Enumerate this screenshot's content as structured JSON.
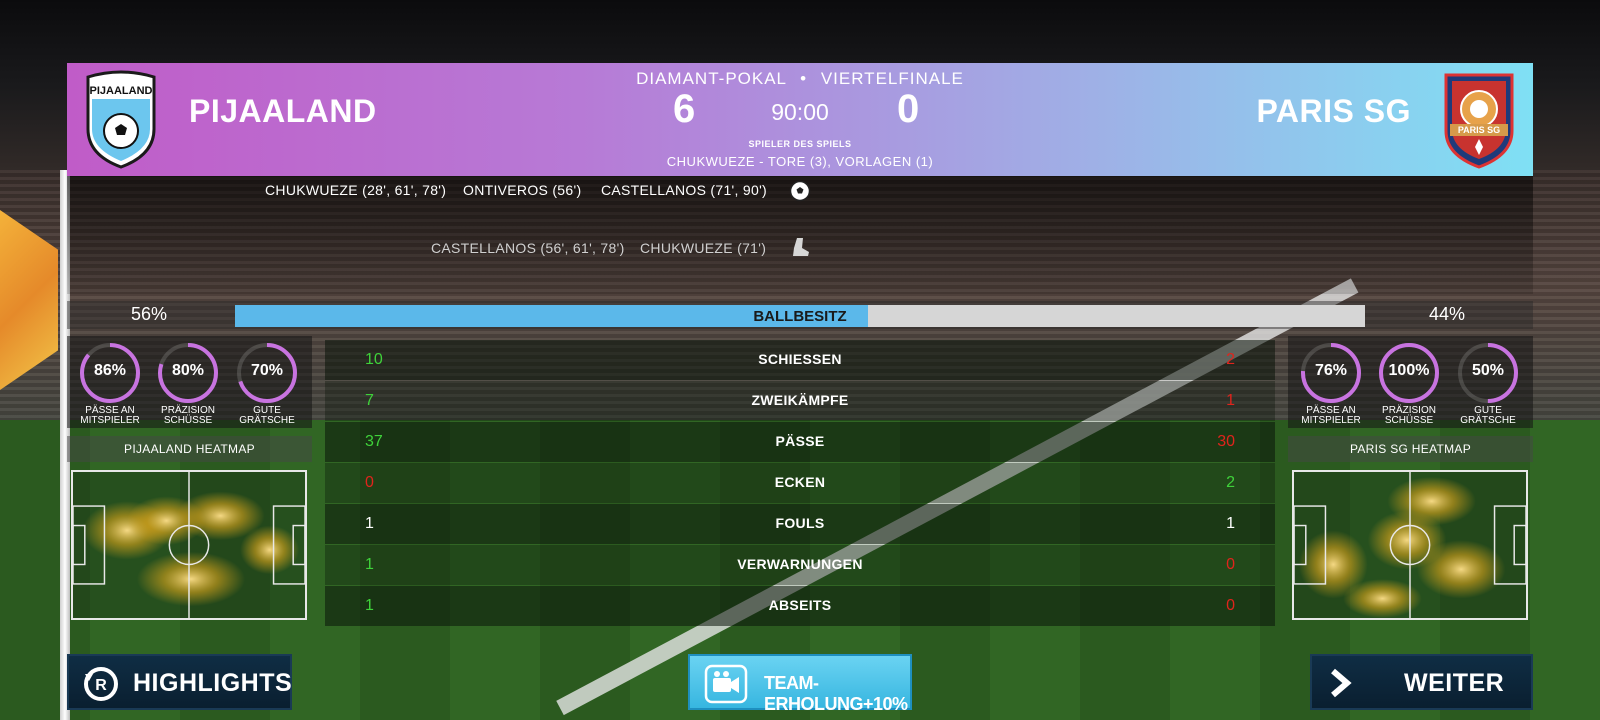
{
  "match": {
    "competition": "DIAMANT-POKAL",
    "separator": "•",
    "round": "VIERTELFINALE",
    "clock": "90:00",
    "home": {
      "name": "PIJAALAND",
      "score": "6",
      "crest_text": "PIJAALAND",
      "crest_icon": "soccer-ball-icon"
    },
    "away": {
      "name": "PARIS SG",
      "score": "0",
      "crest_text": "PARIS SG"
    },
    "motm_label": "SPIELER DES SPIELS",
    "motm_detail": "CHUKWUEZE - TORE (3), VORLAGEN (1)"
  },
  "events": {
    "scorers": [
      "CHUKWUEZE (28', 61', 78')",
      "ONTIVEROS (56')",
      "CASTELLANOS (71', 90')"
    ],
    "scorer_icon": "soccer-ball-icon",
    "assists": [
      "CASTELLANOS (56', 61', 78')",
      "CHUKWUEZE (71')"
    ],
    "assist_icon": "boot-icon"
  },
  "possession": {
    "label": "BALLBESITZ",
    "home_pct_text": "56%",
    "away_pct_text": "44%",
    "home_fraction": 0.56,
    "colors": {
      "home": "#5bb8ea",
      "away": "#d6d6d6"
    }
  },
  "home_panel": {
    "rings": [
      {
        "value": "86%",
        "fraction": 0.86,
        "caption": [
          "PÄSSE AN",
          "MITSPIELER"
        ]
      },
      {
        "value": "80%",
        "fraction": 0.8,
        "caption": [
          "PRÄZISION",
          "SCHÜSSE"
        ]
      },
      {
        "value": "70%",
        "fraction": 0.7,
        "caption": [
          "GUTE",
          "GRÄTSCHE"
        ]
      }
    ],
    "heatmap_title": "PIJAALAND HEATMAP"
  },
  "away_panel": {
    "rings": [
      {
        "value": "76%",
        "fraction": 0.76,
        "caption": [
          "PÄSSE AN",
          "MITSPIELER"
        ]
      },
      {
        "value": "100%",
        "fraction": 1.0,
        "caption": [
          "PRÄZISION",
          "SCHÜSSE"
        ]
      },
      {
        "value": "50%",
        "fraction": 0.5,
        "caption": [
          "GUTE",
          "GRÄTSCHE"
        ]
      }
    ],
    "heatmap_title": "PARIS SG HEATMAP"
  },
  "stats": [
    {
      "name": "SCHIESSEN",
      "home": "10",
      "away": "2",
      "home_color": "green",
      "away_color": "red"
    },
    {
      "name": "ZWEIKÄMPFE",
      "home": "7",
      "away": "1",
      "home_color": "green",
      "away_color": "red"
    },
    {
      "name": "PÄSSE",
      "home": "37",
      "away": "30",
      "home_color": "green",
      "away_color": "red"
    },
    {
      "name": "ECKEN",
      "home": "0",
      "away": "2",
      "home_color": "red",
      "away_color": "green"
    },
    {
      "name": "FOULS",
      "home": "1",
      "away": "1",
      "home_color": "white",
      "away_color": "white"
    },
    {
      "name": "VERWARNUNGEN",
      "home": "1",
      "away": "0",
      "home_color": "green",
      "away_color": "red"
    },
    {
      "name": "ABSEITS",
      "home": "1",
      "away": "0",
      "home_color": "green",
      "away_color": "red"
    }
  ],
  "buttons": {
    "highlights": {
      "label": "HIGHLIGHTS",
      "icon": "replay-icon"
    },
    "boost": {
      "label": "TEAM-ERHOLUNG+10%",
      "icon": "video-camera-icon"
    },
    "next": {
      "label": "WEITER",
      "icon": "chevron-right-icon"
    }
  }
}
